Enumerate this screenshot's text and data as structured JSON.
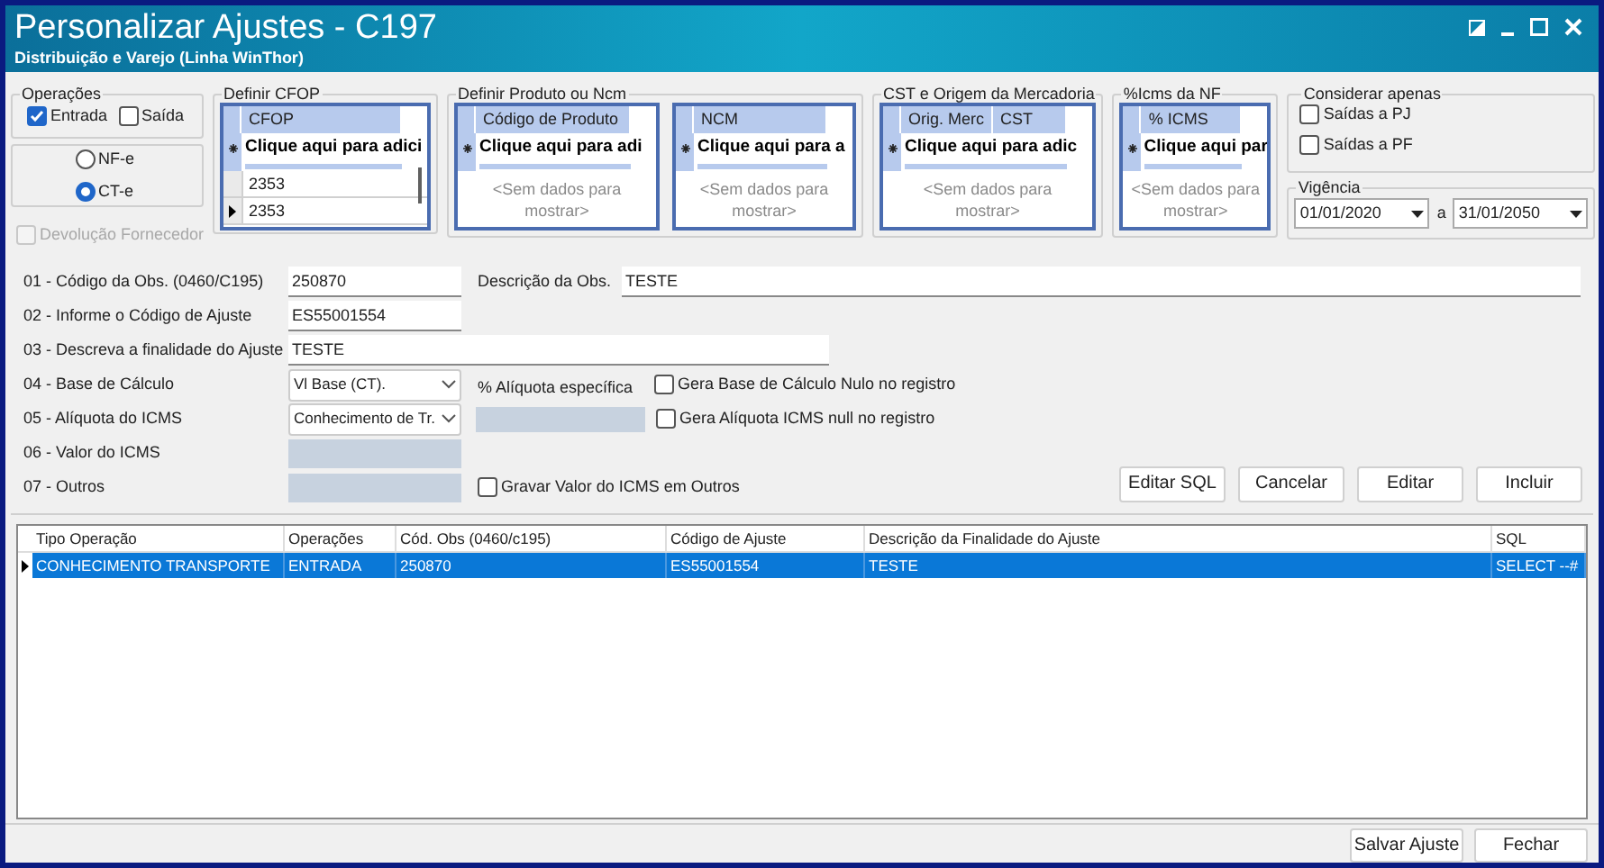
{
  "window": {
    "title": "Personalizar Ajustes - C197",
    "subtitle": "Distribuição e Varejo (Linha WinThor)"
  },
  "operacoes": {
    "title": "Operações",
    "options": [
      {
        "label": "Entrada",
        "checked": true
      },
      {
        "label": "Saída",
        "checked": false
      }
    ],
    "doc_types": [
      {
        "label": "NF-e",
        "selected": false
      },
      {
        "label": "CT-e",
        "selected": true
      }
    ],
    "devolucao": {
      "label": "Devolução Fornecedor",
      "checked": false,
      "disabled": true
    }
  },
  "cfop": {
    "title": "Definir CFOP",
    "grids": [
      {
        "columns": [
          "CFOP"
        ],
        "new_row": "Clique aqui para adici",
        "rows": [
          {
            "value": "2353",
            "current": false
          },
          {
            "value": "2353",
            "current": true
          }
        ]
      }
    ]
  },
  "produto_ncm": {
    "title": "Definir Produto ou Ncm",
    "grids": [
      {
        "columns": [
          "Código de Produto"
        ],
        "new_row": "Clique aqui para adi",
        "empty": "<Sem dados para mostrar>"
      },
      {
        "columns": [
          "NCM"
        ],
        "new_row": "Clique aqui para a",
        "empty": "<Sem dados para mostrar>"
      }
    ]
  },
  "cst": {
    "title": "CST e Origem da Mercadoria",
    "grids": [
      {
        "columns": [
          "Orig. Merc",
          "CST"
        ],
        "new_row": "Clique aqui para adic",
        "empty": "<Sem dados para mostrar>"
      }
    ]
  },
  "icms_nf": {
    "title": "%Icms da NF",
    "grids": [
      {
        "columns": [
          "% ICMS"
        ],
        "new_row": "Clique aqui par",
        "empty": "<Sem dados para mostrar>"
      }
    ]
  },
  "considerar": {
    "title": "Considerar apenas",
    "options": [
      {
        "label": "Saídas a PJ",
        "checked": false
      },
      {
        "label": "Saídas a PF",
        "checked": false
      }
    ]
  },
  "vigencia": {
    "title": "Vigência",
    "from": "01/01/2020",
    "separator": "a",
    "to": "31/01/2050"
  },
  "form": {
    "fields": [
      {
        "label": "01 - Código da Obs. (0460/C195)",
        "kind": "text",
        "value": "250870"
      },
      {
        "label": "02 - Informe o Código de Ajuste",
        "kind": "text",
        "value": "ES55001554"
      },
      {
        "label": "03 - Descreva a finalidade do Ajuste",
        "kind": "wide",
        "value": "TESTE"
      },
      {
        "label": "04 - Base de Cálculo",
        "kind": "select",
        "value": "Vl Base (CT)."
      },
      {
        "label": "05 - Alíquota do ICMS",
        "kind": "select",
        "value": "Conhecimento de Tr."
      },
      {
        "label": "06 - Valor do ICMS",
        "kind": "disabled"
      },
      {
        "label": "07 - Outros",
        "kind": "disabled"
      }
    ],
    "description": {
      "label": "Descrição da Obs.",
      "value": "TESTE"
    },
    "specific_rate": {
      "label": "% Alíquota específica"
    },
    "options": [
      {
        "label": "Gera Base de Cálculo Nulo no registro",
        "checked": false
      },
      {
        "label": "Gera Alíquota ICMS null no registro",
        "checked": false
      },
      {
        "label": "Gravar Valor do ICMS em Outros",
        "checked": false
      }
    ],
    "actions": [
      "Editar SQL",
      "Cancelar",
      "Editar",
      "Incluir"
    ]
  },
  "table": {
    "columns": [
      "Tipo Operação",
      "Operações",
      "Cód. Obs (0460/c195)",
      "Código de Ajuste",
      "Descrição da Finalidade do Ajuste",
      "SQL"
    ],
    "rows": [
      {
        "selected": true,
        "cells": [
          "CONHECIMENTO TRANSPORTE",
          "ENTRADA",
          "250870",
          "ES55001554",
          "TESTE",
          "SELECT --#"
        ]
      }
    ]
  },
  "footer": {
    "buttons": [
      "Salvar Ajuste",
      "Fechar"
    ]
  }
}
